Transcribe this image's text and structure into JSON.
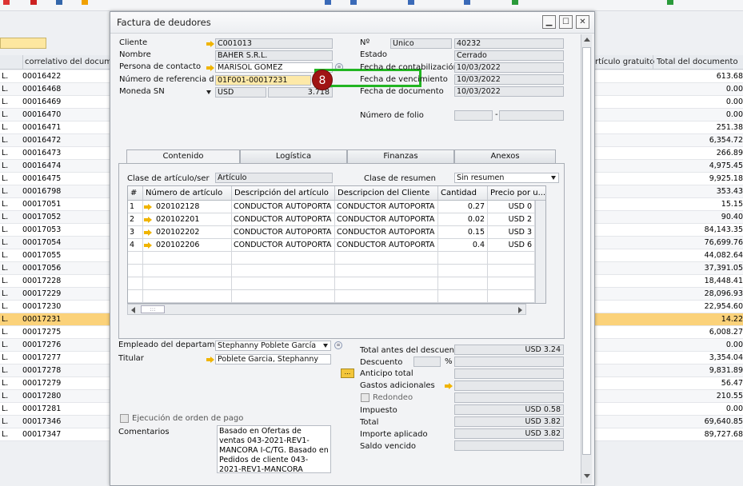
{
  "background": {
    "col_correlativo": "correlativo del documen",
    "col_articulo_gratuito": "rtículo gratuito",
    "col_total": "Total del documento",
    "rows": [
      {
        "p": "L.",
        "c": "00016422",
        "t": "613.68"
      },
      {
        "p": "L.",
        "c": "00016468",
        "t": "0.00"
      },
      {
        "p": "L.",
        "c": "00016469",
        "t": "0.00"
      },
      {
        "p": "L.",
        "c": "00016470",
        "t": "0.00"
      },
      {
        "p": "L.",
        "c": "00016471",
        "t": "251.38"
      },
      {
        "p": "L.",
        "c": "00016472",
        "t": "6,354.72"
      },
      {
        "p": "L.",
        "c": "00016473",
        "t": "266.89"
      },
      {
        "p": "L.",
        "c": "00016474",
        "t": "4,975.45"
      },
      {
        "p": "L.",
        "c": "00016475",
        "t": "9,925.18"
      },
      {
        "p": "L.",
        "c": "00016798",
        "t": "353.43"
      },
      {
        "p": "L.",
        "c": "00017051",
        "t": "15.15"
      },
      {
        "p": "L.",
        "c": "00017052",
        "t": "90.40"
      },
      {
        "p": "L.",
        "c": "00017053",
        "t": "84,143.35"
      },
      {
        "p": "L.",
        "c": "00017054",
        "t": "76,699.76"
      },
      {
        "p": "L.",
        "c": "00017055",
        "t": "44,082.64"
      },
      {
        "p": "L.",
        "c": "00017056",
        "t": "37,391.05"
      },
      {
        "p": "L.",
        "c": "00017228",
        "t": "18,448.41"
      },
      {
        "p": "L.",
        "c": "00017229",
        "t": "28,096.93"
      },
      {
        "p": "L.",
        "c": "00017230",
        "t": "22,954.60"
      },
      {
        "p": "L.",
        "c": "00017231",
        "t": "14.22"
      },
      {
        "p": "L.",
        "c": "00017275",
        "t": "6,008.27"
      },
      {
        "p": "L.",
        "c": "00017276",
        "t": "0.00"
      },
      {
        "p": "L.",
        "c": "00017277",
        "t": "3,354.04"
      },
      {
        "p": "L.",
        "c": "00017278",
        "t": "9,831.89"
      },
      {
        "p": "L.",
        "c": "00017279",
        "t": "56.47"
      },
      {
        "p": "L.",
        "c": "00017280",
        "t": "210.55"
      },
      {
        "p": "L.",
        "c": "00017281",
        "t": "0.00"
      },
      {
        "p": "L.",
        "c": "00017346",
        "t": "69,640.85"
      },
      {
        "p": "L.",
        "c": "00017347",
        "t": "89,727.68"
      }
    ],
    "selected_row": 19
  },
  "dialog": {
    "title": "Factura de deudores",
    "cliente_label": "Cliente",
    "cliente_value": "C001013",
    "nombre_label": "Nombre",
    "nombre_value": "BAHER S.R.L.",
    "contacto_label": "Persona de contacto",
    "contacto_value": "MARISOL GOMEZ",
    "ref_label": "Número de referencia d",
    "ref_value": "01F001-00017231",
    "moneda_label": "Moneda SN",
    "moneda_value": "USD",
    "moneda_rate": "3.718",
    "no_label": "Nº",
    "no_series": "Unico",
    "no_value": "40232",
    "estado_label": "Estado",
    "estado_value": "Cerrado",
    "fecha_cont_label": "Fecha de contabilización",
    "fecha_cont_value": "10/03/2022",
    "fecha_venc_label": "Fecha de vencimiento",
    "fecha_venc_value": "10/03/2022",
    "fecha_doc_label": "Fecha de documento",
    "fecha_doc_value": "10/03/2022",
    "folio_label": "Número de folio",
    "folio_sep": "-",
    "badge": "8",
    "tabs": [
      "Contenido",
      "Logística",
      "Finanzas",
      "Anexos"
    ],
    "clase_art_label": "Clase de artículo/ser",
    "clase_art_value": "Artículo",
    "clase_res_label": "Clase de resumen",
    "clase_res_value": "Sin resumen",
    "grid_headers": [
      "#",
      "Número de artículo",
      "Descripción del artículo",
      "Descripcion del Cliente",
      "Cantidad",
      "Precio por u..."
    ],
    "grid_rows": [
      {
        "n": "1",
        "art": "020102128",
        "desc": "CONDUCTOR AUTOPORTA",
        "cli": "CONDUCTOR AUTOPORTA",
        "cant": "0.27",
        "precio": "USD 0"
      },
      {
        "n": "2",
        "art": "020102201",
        "desc": "CONDUCTOR AUTOPORTA",
        "cli": "CONDUCTOR AUTOPORTA",
        "cant": "0.02",
        "precio": "USD 2"
      },
      {
        "n": "3",
        "art": "020102202",
        "desc": "CONDUCTOR AUTOPORTA",
        "cli": "CONDUCTOR AUTOPORTA",
        "cant": "0.15",
        "precio": "USD 3"
      },
      {
        "n": "4",
        "art": "020102206",
        "desc": "CONDUCTOR AUTOPORTA",
        "cli": "CONDUCTOR AUTOPORTA",
        "cant": "0.4",
        "precio": "USD 6"
      }
    ],
    "scroll_grip": ":::",
    "empleado_label": "Empleado del departam",
    "empleado_value": "Stephanny Poblete García",
    "titular_label": "Titular",
    "titular_value": "Poblete Garcia, Stephanny",
    "ejecucion_label": "Ejecución de orden de pago",
    "comentarios_label": "Comentarios",
    "comentarios_value": "Basado en Ofertas de ventas 043-2021-REV1-MANCORA I-C/TG. Basado en Pedidos de cliente 043-2021-REV1-MANCORA",
    "total_antes_label": "Total antes del descuento",
    "total_antes_value": "USD 3.24",
    "descuento_label": "Descuento",
    "descuento_pct": "%",
    "anticipo_label": "Anticipo total",
    "anticipo_btn": "...",
    "gastos_label": "Gastos adicionales",
    "redondeo_label": "Redondeo",
    "impuesto_label": "Impuesto",
    "impuesto_value": "USD 0.58",
    "total_label": "Total",
    "total_value": "USD 3.82",
    "importe_label": "Importe aplicado",
    "importe_value": "USD 3.82",
    "saldo_label": "Saldo vencido"
  },
  "colors": {
    "highlight_green": "#22b522",
    "badge_red": "#a01414",
    "selected_row": "#fbd27a",
    "link_arrow": "#f0b400"
  }
}
